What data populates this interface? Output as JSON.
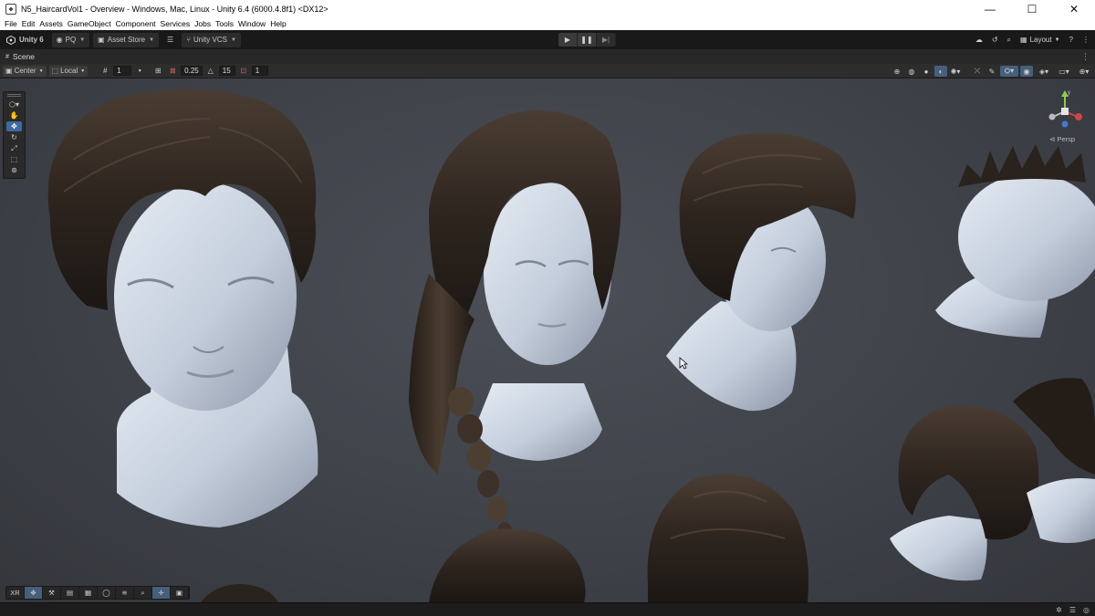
{
  "window": {
    "title": "N5_HaircardVol1 - Overview - Windows, Mac, Linux - Unity 6.4 (6000.4.8f1) <DX12>",
    "minimize": "—",
    "maximize": "☐",
    "close": "✕"
  },
  "menu": [
    "File",
    "Edit",
    "Assets",
    "GameObject",
    "Component",
    "Services",
    "Jobs",
    "Tools",
    "Window",
    "Help"
  ],
  "toolbar": {
    "unity_label": "Unity 6",
    "account_label": "PQ",
    "asset_store_label": "Asset Store",
    "vcs_label": "Unity VCS",
    "layout_label": "Layout"
  },
  "scene": {
    "tab_label": "Scene",
    "pivot_label": "Center",
    "space_label": "Local",
    "grid_value": "1",
    "snap_value": "0.25",
    "rotate_snap_value": "15",
    "scale_snap_value": "1",
    "camera_label": "Persp"
  },
  "overlay": {
    "xr_label": "XR"
  },
  "colors": {
    "accent_blue": "#3e6aa0",
    "active_toggle": "#46607c",
    "viewport_bg": "#44474e",
    "skin": "#c9d3df",
    "hair_dark": "#2e2620"
  }
}
